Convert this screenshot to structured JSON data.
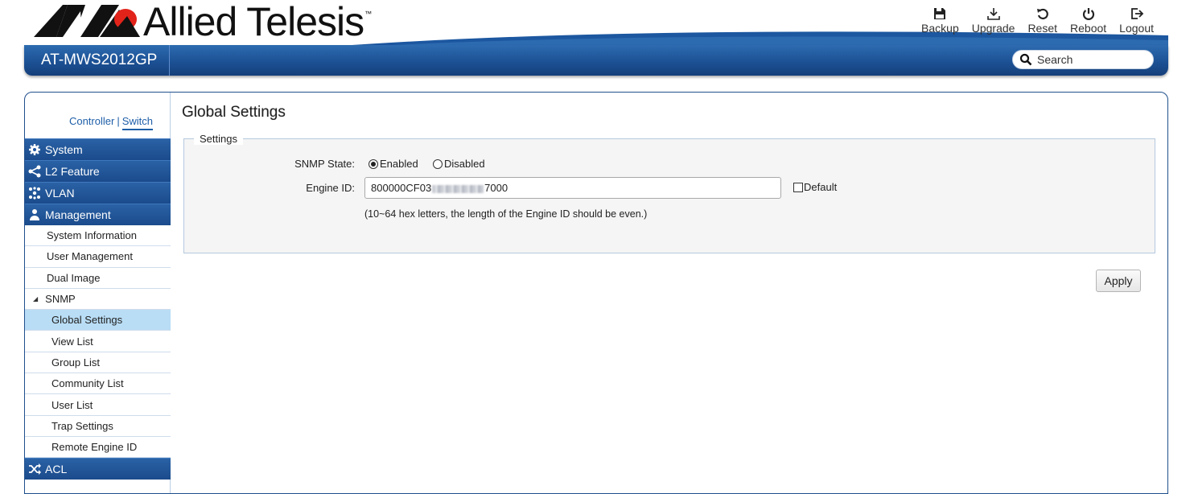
{
  "brand": {
    "name": "Allied Telesis",
    "tm": "™",
    "model": "AT-MWS2012GP"
  },
  "toolbar": [
    {
      "label": "Backup",
      "icon": "floppy-icon"
    },
    {
      "label": "Upgrade",
      "icon": "download-icon"
    },
    {
      "label": "Reset",
      "icon": "reset-icon"
    },
    {
      "label": "Reboot",
      "icon": "power-icon"
    },
    {
      "label": "Logout",
      "icon": "logout-icon"
    }
  ],
  "search": {
    "placeholder": "Search"
  },
  "mode": {
    "controller": "Controller",
    "separator": "|",
    "switch": "Switch"
  },
  "sidebar": {
    "categories": [
      {
        "label": "System",
        "icon": "gear-icon"
      },
      {
        "label": "L2 Feature",
        "icon": "share-icon"
      },
      {
        "label": "VLAN",
        "icon": "network-icon"
      },
      {
        "label": "Management",
        "icon": "users-icon"
      },
      {
        "label": "ACL",
        "icon": "shuffle-icon"
      }
    ],
    "management_items": [
      "System Information",
      "User Management",
      "Dual Image"
    ],
    "snmp": {
      "label": "SNMP",
      "collapse_glyph": "◢"
    },
    "snmp_items": [
      "Global Settings",
      "View List",
      "Group List",
      "Community List",
      "User List",
      "Trap Settings",
      "Remote Engine ID"
    ]
  },
  "page": {
    "title": "Global Settings",
    "settings_legend": "Settings",
    "snmp_state_label": "SNMP State:",
    "enabled_label": "Enabled",
    "disabled_label": "Disabled",
    "snmp_state_value": "Enabled",
    "engine_id_label": "Engine ID:",
    "engine_id_prefix": "800000CF03",
    "engine_id_suffix": "7000",
    "default_label": "Default",
    "default_checked": false,
    "hint": "(10~64 hex letters, the length of the Engine ID should be even.)",
    "apply_label": "Apply"
  },
  "colors": {
    "accent": "#1b4f92",
    "selected": "#b9ddf5",
    "logo_red": "#e2231a"
  }
}
